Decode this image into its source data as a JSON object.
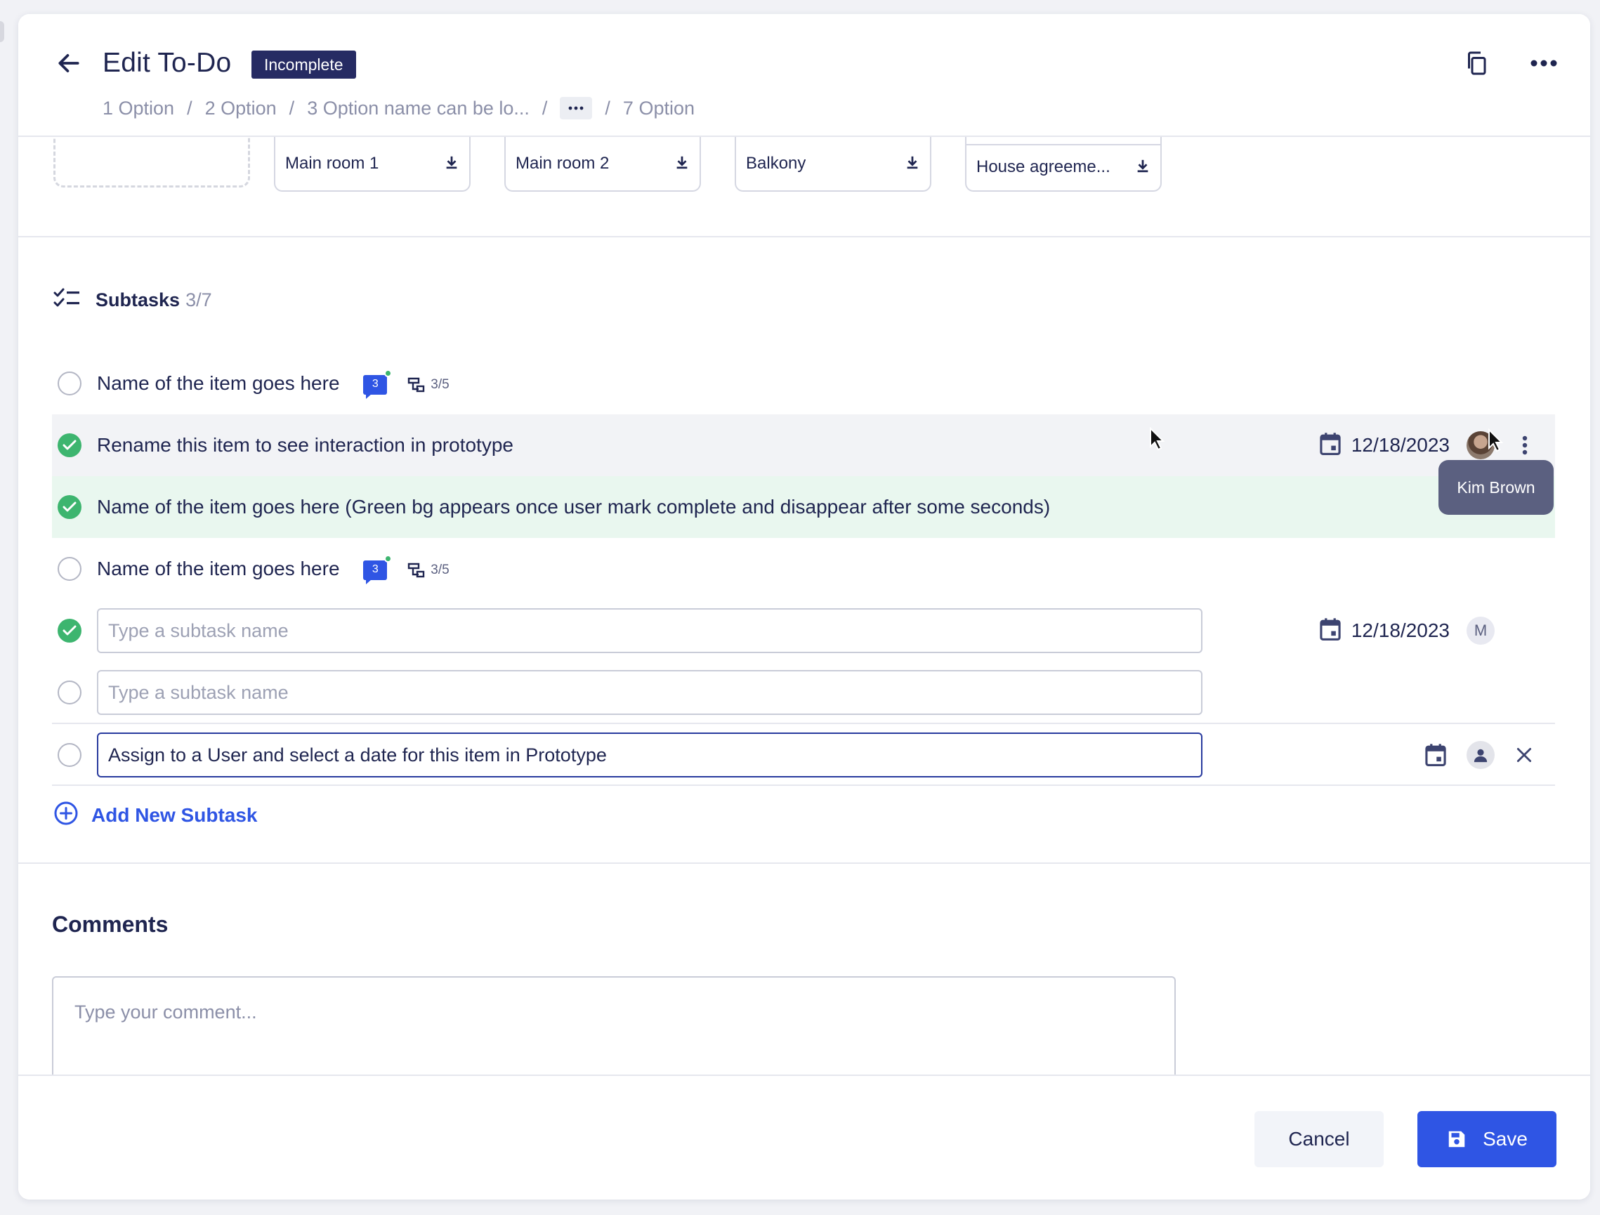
{
  "header": {
    "title": "Edit To-Do",
    "status": "Incomplete",
    "breadcrumb": [
      "1 Option",
      "2 Option",
      "3 Option name can be lo...",
      "7 Option"
    ],
    "breadcrumb_more": "···"
  },
  "attachments": [
    {
      "label": "Main room 1"
    },
    {
      "label": "Main room 2"
    },
    {
      "label": "Balkony"
    },
    {
      "label": "House agreeme..."
    }
  ],
  "subtasks": {
    "title": "Subtasks",
    "count": "3/7",
    "items": [
      {
        "name": "Name of the item goes here",
        "done": false,
        "comments": "3",
        "sub_count": "3/5"
      },
      {
        "name": "Rename this item to see interaction in prototype",
        "done": true,
        "date": "12/18/2023",
        "assignee": "Kim Brown"
      },
      {
        "name": "Name of the item goes here (Green bg appears once user mark complete and disappear after some seconds)",
        "done": true
      },
      {
        "name": "Name of the item goes here",
        "done": false,
        "comments": "3",
        "sub_count": "3/5"
      }
    ],
    "input_rows": [
      {
        "placeholder": "Type a subtask name",
        "done": true,
        "date": "12/18/2023",
        "avatar_letter": "M"
      },
      {
        "placeholder": "Type a subtask name",
        "done": false
      },
      {
        "value": "Assign to a User and select a date for this item in Prototype",
        "done": false
      }
    ],
    "add_label": "Add New Subtask",
    "tooltip": "Kim Brown"
  },
  "comments": {
    "title": "Comments",
    "placeholder": "Type your comment..."
  },
  "footer": {
    "cancel_label": "Cancel",
    "save_label": "Save"
  },
  "colors": {
    "primary": "#2f55e4",
    "navy": "#1f2550",
    "success": "#3db56f",
    "flash_bg": "#e9f7ef",
    "badge_bg": "#262b63"
  },
  "icons": [
    "back-arrow-icon",
    "copy-icon",
    "more-horizontal-icon",
    "download-icon",
    "checklist-icon",
    "comment-icon",
    "subtask-icon",
    "calendar-icon",
    "kebab-icon",
    "user-icon",
    "close-icon",
    "add-circle-icon",
    "save-icon",
    "cursor-icon"
  ]
}
